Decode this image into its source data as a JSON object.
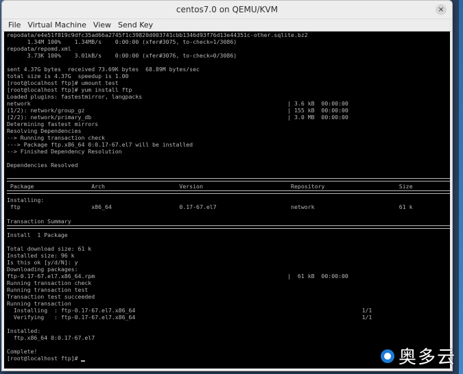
{
  "window": {
    "title": "centos7.0 on QEMU/KVM",
    "close_label": "×"
  },
  "menu": [
    "File",
    "Virtual Machine",
    "View",
    "Send Key"
  ],
  "terminal": {
    "lines": [
      "repodata/e4e51f819c9dfc35ad66a2745f1c39820d003741cbb1346d93f76d13e44351c-other.sqlite.bz2",
      "      1.34M 100%    1.34MB/s    0:00:00 (xfer#3075, to-check=1/3086)",
      "repodata/repomd.xml",
      "      3.73K 100%    3.01kB/s    0:00:00 (xfer#3076, to-check=0/3086)",
      "",
      "sent 4.37G bytes  received 73.69K bytes  68.89M bytes/sec",
      "total size is 4.37G  speedup is 1.00",
      "[root@localhost ftp]# umount test",
      "[root@localhost ftp]# yum install ftp",
      "Loaded plugins: fastestmirror, langpacks",
      "network                                                                            | 3.6 kB  00:00:00",
      "(1/2): network/group_gz                                                            | 155 kB  00:00:00",
      "(2/2): network/primary_db                                                          | 3.0 MB  00:00:00",
      "Determining fastest mirrors",
      "Resolving Dependencies",
      "--> Running transaction check",
      "---> Package ftp.x86_64 0:0.17-67.el7 will be installed",
      "--> Finished Dependency Resolution",
      "",
      "Dependencies Resolved",
      "",
      "",
      " Package                 Arch                      Version                          Repository                      Size",
      "",
      "Installing:",
      " ftp                     x86_64                    0.17-67.el7                      network                         61 k",
      "",
      "Transaction Summary",
      "",
      "Install  1 Package",
      "",
      "Total download size: 61 k",
      "Installed size: 96 k",
      "Is this ok [y/d/N]: y",
      "Downloading packages:",
      "ftp-0.17-67.el7.x86_64.rpm                                                         |  61 kB  00:00:00",
      "Running transaction check",
      "Running transaction test",
      "Transaction test succeeded",
      "Running transaction",
      "  Installing  : ftp-0.17-67.el7.x86_64                                                                   1/1",
      "  Verifying   : ftp-0.17-67.el7.x86_64                                                                   1/1",
      "",
      "Installed:",
      "  ftp.x86_64 0:0.17-67.el7",
      "",
      "Complete!",
      "[root@localhost ftp]# "
    ]
  },
  "watermark": {
    "text": "奥多云"
  }
}
